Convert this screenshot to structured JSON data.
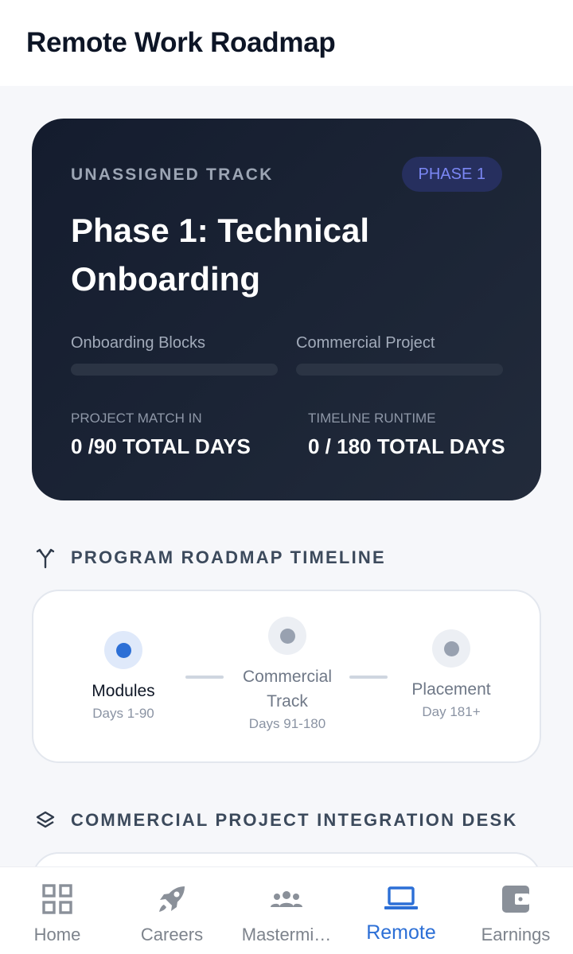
{
  "header": {
    "title": "Remote Work Roadmap"
  },
  "hero": {
    "kicker": "UNASSIGNED TRACK",
    "phase_badge": "PHASE 1",
    "title": "Phase 1: Technical Onboarding",
    "progress": [
      {
        "label": "Onboarding Blocks",
        "value": 0
      },
      {
        "label": "Commercial Project",
        "value": 0
      }
    ],
    "stats": [
      {
        "label": "PROJECT MATCH IN",
        "value": "0 /90 TOTAL DAYS"
      },
      {
        "label": "TIMELINE RUNTIME",
        "value": "0 / 180 TOTAL DAYS"
      }
    ]
  },
  "timeline": {
    "title": "PROGRAM ROADMAP TIMELINE",
    "icon": "fork-icon",
    "steps": [
      {
        "name": "Modules",
        "range": "Days 1-90",
        "active": true
      },
      {
        "name": "Commercial Track",
        "range": "Days 91-180",
        "active": false
      },
      {
        "name": "Placement",
        "range": "Day 181+",
        "active": false
      }
    ]
  },
  "integration": {
    "title": "COMMERCIAL PROJECT INTEGRATION DESK",
    "icon": "layers-icon"
  },
  "nav": {
    "items": [
      {
        "label": "Home",
        "icon": "grid-icon",
        "active": false
      },
      {
        "label": "Careers",
        "icon": "rocket-icon",
        "active": false
      },
      {
        "label": "Mastermi…",
        "icon": "group-icon",
        "active": false
      },
      {
        "label": "Remote",
        "icon": "laptop-icon",
        "active": true
      },
      {
        "label": "Earnings",
        "icon": "wallet-icon",
        "active": false
      }
    ]
  },
  "colors": {
    "accent": "#2c6fd6",
    "hero_bg": "#1a2233",
    "badge_text": "#7b87f4",
    "inactive": "#7d838c"
  }
}
